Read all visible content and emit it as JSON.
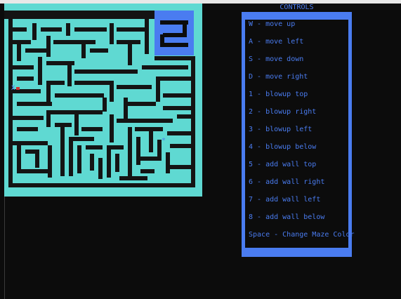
{
  "colors": {
    "background": "#0c0c0c",
    "maze_path": "#5fd9d2",
    "maze_wall": "#141414",
    "accent": "#4a7cf0",
    "player_marker": "#d03030"
  },
  "maze": {
    "player_marker_text": "X",
    "target_marker_text": "*"
  },
  "controls": {
    "title": "CONTROLS",
    "items": [
      "W - move up",
      "A - move left",
      "S - move down",
      "D - move right",
      "1 - blowup top",
      "2 - blowup right",
      "3 - blowup left",
      "4 - blowup below",
      "5 - add wall top",
      "6 - add wall right",
      "7 - add wall left",
      "8 - add wall below",
      "Space - Change Maze Color"
    ]
  }
}
